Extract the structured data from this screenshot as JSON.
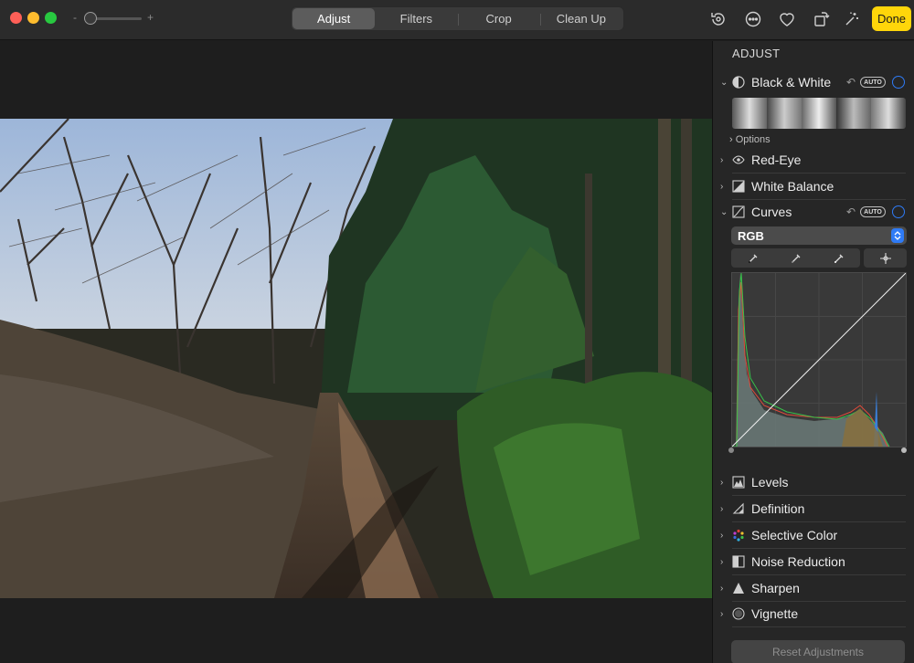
{
  "toolbar": {
    "zoom_minus": "-",
    "zoom_plus": "+",
    "tabs": [
      {
        "label": "Adjust",
        "active": true
      },
      {
        "label": "Filters",
        "active": false
      },
      {
        "label": "Crop",
        "active": false
      },
      {
        "label": "Clean Up",
        "active": false
      }
    ],
    "icons": [
      "rotate-edit-icon",
      "more-icon",
      "heart-icon",
      "rotate-icon",
      "magic-wand-icon"
    ],
    "done_label": "Done",
    "colors": {
      "accent": "#ffd60a",
      "close": "#ff5f57",
      "minimize": "#febc2e",
      "zoom": "#28c840"
    }
  },
  "sidebar": {
    "heading": "ADJUST",
    "black_white": {
      "label": "Black & White",
      "auto": "AUTO",
      "options": "Options"
    },
    "red_eye": {
      "label": "Red-Eye"
    },
    "white_balance": {
      "label": "White Balance"
    },
    "curves": {
      "label": "Curves",
      "auto": "AUTO",
      "channel": "RGB"
    },
    "sections": [
      {
        "label": "Levels",
        "icon": "levels-icon"
      },
      {
        "label": "Definition",
        "icon": "definition-icon"
      },
      {
        "label": "Selective Color",
        "icon": "selective-color-icon"
      },
      {
        "label": "Noise Reduction",
        "icon": "noise-reduction-icon"
      },
      {
        "label": "Sharpen",
        "icon": "sharpen-icon"
      },
      {
        "label": "Vignette",
        "icon": "vignette-icon"
      }
    ],
    "reset_label": "Reset Adjustments",
    "toggle_color": "#2f7bf6"
  }
}
